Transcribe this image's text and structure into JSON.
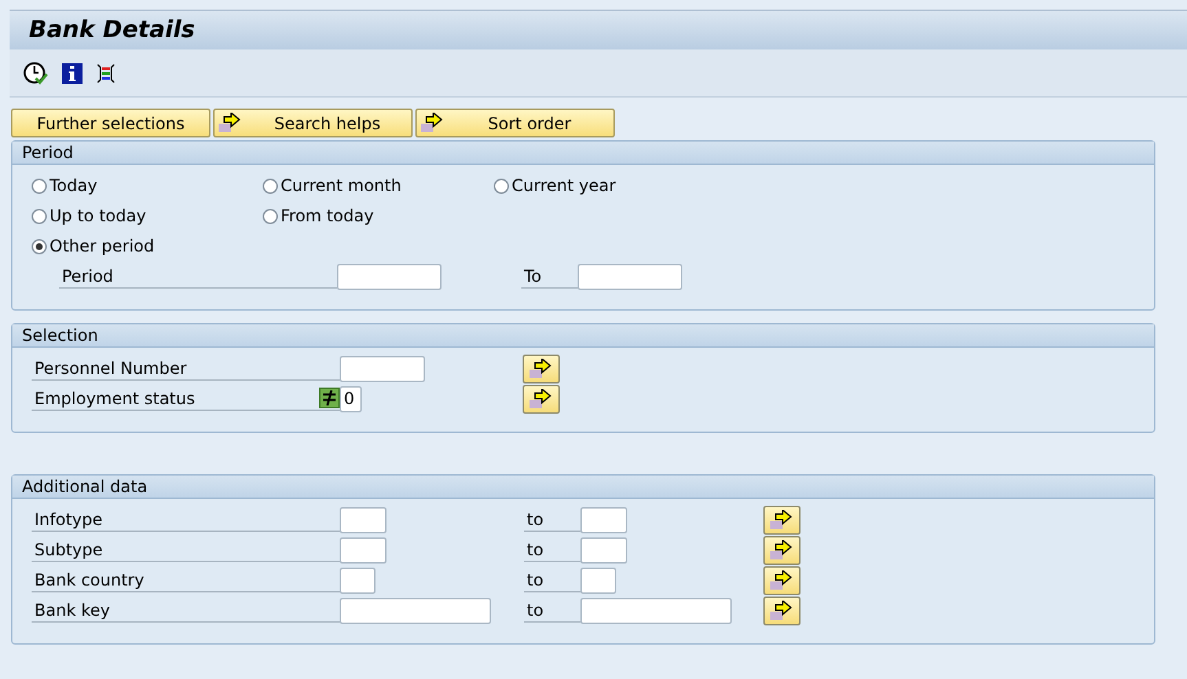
{
  "title": "Bank Details",
  "buttons": [
    {
      "label": "Further selections",
      "arrow": false
    },
    {
      "label": "Search helps",
      "arrow": true
    },
    {
      "label": "Sort order",
      "arrow": true
    }
  ],
  "period": {
    "title": "Period",
    "option_rows": [
      {
        "options": [
          {
            "label": "Today",
            "selected": false
          },
          {
            "label": "Current month",
            "selected": false
          },
          {
            "label": "Current year",
            "selected": false
          }
        ]
      },
      {
        "options": [
          {
            "label": "Up to today",
            "selected": false
          },
          {
            "label": "From today",
            "selected": false
          }
        ]
      },
      {
        "options": [
          {
            "label": "Other period",
            "selected": true
          }
        ]
      }
    ],
    "range": {
      "label": "Period",
      "to_label": "To"
    }
  },
  "selection": {
    "title": "Selection",
    "rows": [
      {
        "kind": "plain",
        "label": "Personnel Number"
      },
      {
        "kind": "operator",
        "label": "Employment status",
        "value": "0"
      }
    ]
  },
  "additional": {
    "title": "Additional data",
    "rows": [
      {
        "label": "Infotype",
        "to_label": "to"
      },
      {
        "label": "Subtype",
        "to_label": "to"
      },
      {
        "label": "Bank country",
        "to_label": "to"
      },
      {
        "label": "Bank key",
        "to_label": "to"
      }
    ]
  }
}
